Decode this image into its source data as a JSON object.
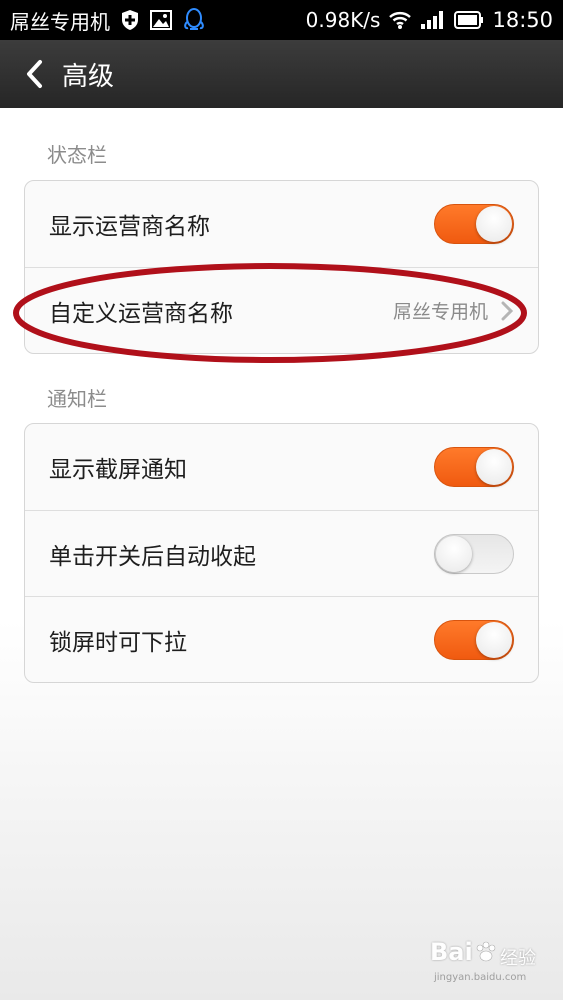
{
  "status_bar": {
    "carrier": "屌丝专用机",
    "speed": "0.98K/s",
    "time": "18:50",
    "icons": [
      "shield-icon",
      "image-icon",
      "qq-icon",
      "wifi-icon",
      "signal-icon",
      "battery-icon"
    ]
  },
  "action_bar": {
    "title": "高级"
  },
  "sections": {
    "status_bar_section": {
      "header": "状态栏",
      "items": [
        {
          "label": "显示运营商名称",
          "type": "toggle",
          "on": true
        },
        {
          "label": "自定义运营商名称",
          "type": "link",
          "value": "屌丝专用机"
        }
      ]
    },
    "notification_section": {
      "header": "通知栏",
      "items": [
        {
          "label": "显示截屏通知",
          "type": "toggle",
          "on": true
        },
        {
          "label": "单击开关后自动收起",
          "type": "toggle",
          "on": false
        },
        {
          "label": "锁屏时可下拉",
          "type": "toggle",
          "on": true
        }
      ]
    }
  },
  "colors": {
    "toggle_on": "#f26a1b",
    "highlight_ellipse": "#b0101a",
    "action_bar": "#2f2f2f"
  },
  "watermark": {
    "brand": "Bai",
    "text": "经验",
    "url": "jingyan.baidu.com"
  }
}
